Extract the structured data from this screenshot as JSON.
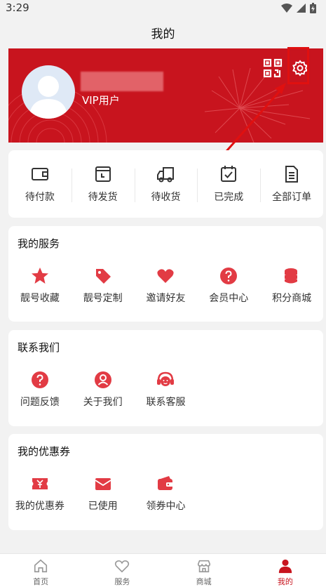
{
  "status_bar": {
    "time": "3:29"
  },
  "header": {
    "title": "我的"
  },
  "profile": {
    "vip_label": "VIP用户"
  },
  "orders": [
    {
      "label": "待付款",
      "icon": "wallet-icon"
    },
    {
      "label": "待发货",
      "icon": "package-icon"
    },
    {
      "label": "待收货",
      "icon": "truck-icon"
    },
    {
      "label": "已完成",
      "icon": "calendar-check-icon"
    },
    {
      "label": "全部订单",
      "icon": "document-icon"
    }
  ],
  "services": {
    "title": "我的服务",
    "items": [
      {
        "label": "靓号收藏",
        "icon": "star-icon"
      },
      {
        "label": "靓号定制",
        "icon": "tag-icon"
      },
      {
        "label": "邀请好友",
        "icon": "heart-icon"
      },
      {
        "label": "会员中心",
        "icon": "question-icon"
      },
      {
        "label": "积分商城",
        "icon": "coins-icon"
      }
    ]
  },
  "contact": {
    "title": "联系我们",
    "items": [
      {
        "label": "问题反馈",
        "icon": "question-icon"
      },
      {
        "label": "关于我们",
        "icon": "user-icon"
      },
      {
        "label": "联系客服",
        "icon": "headset-icon"
      }
    ]
  },
  "coupons": {
    "title": "我的优惠券",
    "items": [
      {
        "label": "我的优惠券",
        "icon": "coupon-icon"
      },
      {
        "label": "已使用",
        "icon": "envelope-icon"
      },
      {
        "label": "领券中心",
        "icon": "wallet-icon"
      }
    ]
  },
  "tabs": [
    {
      "label": "首页",
      "icon": "home-icon"
    },
    {
      "label": "服务",
      "icon": "heart-icon"
    },
    {
      "label": "商城",
      "icon": "store-icon"
    },
    {
      "label": "我的",
      "icon": "person-icon",
      "active": true
    }
  ],
  "colors": {
    "brand": "#c8141e",
    "background": "#f2f2f2",
    "icon_red": "#e23b44"
  }
}
